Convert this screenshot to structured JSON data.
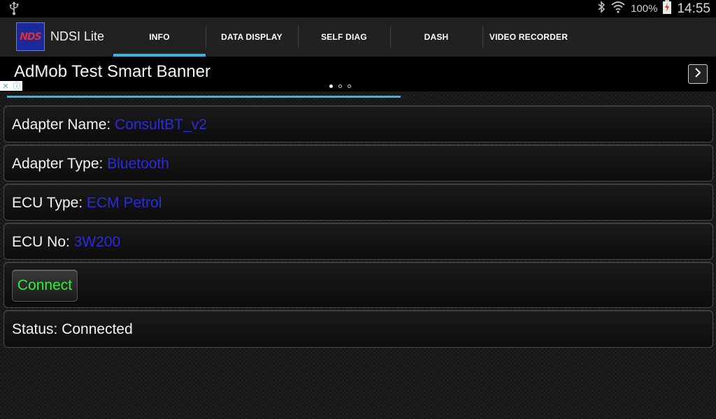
{
  "statusbar": {
    "battery_percent": "100%",
    "time": "14:55",
    "icons": [
      "usb-icon",
      "bluetooth-icon",
      "wifi-icon",
      "battery-icon"
    ]
  },
  "actionbar": {
    "app_logo_text": "NDS",
    "app_title": "NDSI Lite",
    "tabs": [
      {
        "label": "INFO",
        "active": true
      },
      {
        "label": "DATA DISPLAY",
        "active": false
      },
      {
        "label": "SELF DIAG",
        "active": false
      },
      {
        "label": "DASH",
        "active": false
      },
      {
        "label": "VIDEO RECORDER",
        "active": false
      }
    ]
  },
  "ad": {
    "text": "AdMob Test Smart Banner",
    "page_count": 3,
    "current_page": 1
  },
  "colors": {
    "accent": "#33b5e5",
    "value_text": "#2b2be0",
    "connect_text": "#33ee33"
  },
  "info": {
    "adapter_name": {
      "label": "Adapter Name:",
      "value": "ConsultBT_v2"
    },
    "adapter_type": {
      "label": "Adapter Type:",
      "value": "Bluetooth"
    },
    "ecu_type": {
      "label": "ECU Type:",
      "value": "ECM Petrol"
    },
    "ecu_no": {
      "label": "ECU No:",
      "value": "3W200"
    },
    "connect_label": "Connect",
    "status": "Status: Connected"
  }
}
